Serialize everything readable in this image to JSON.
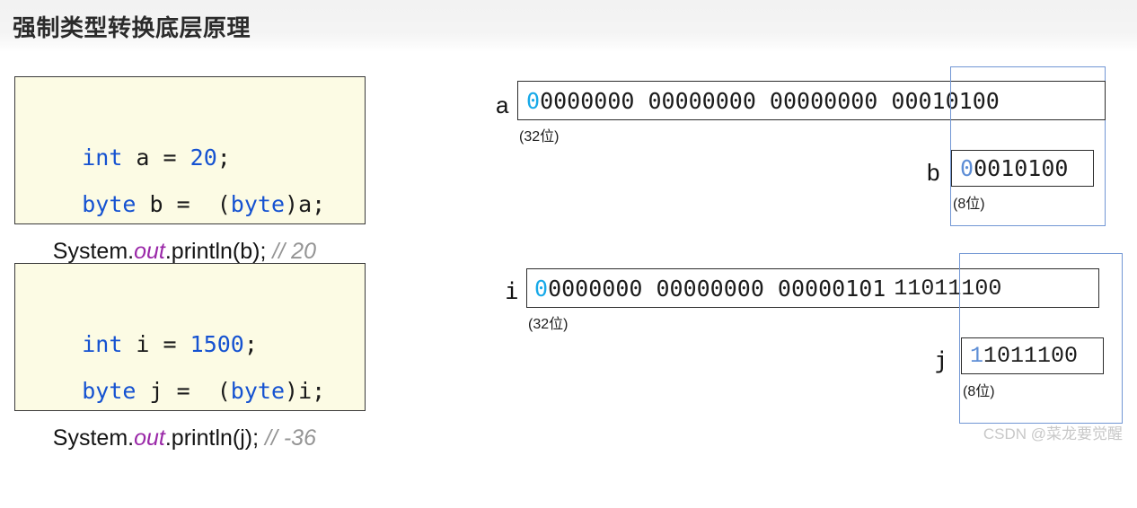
{
  "header": {
    "title": "强制类型转换底层原理"
  },
  "code_blocks": [
    {
      "id": "code-box-1",
      "lines": [
        {
          "type": "mono",
          "parts": [
            {
              "text": "int",
              "style": "kw"
            },
            {
              "text": " a = ",
              "style": "plain"
            },
            {
              "text": "20",
              "style": "num"
            },
            {
              "text": ";",
              "style": "plain"
            }
          ]
        },
        {
          "type": "mono",
          "parts": [
            {
              "text": "byte",
              "style": "kw"
            },
            {
              "text": " b =  (",
              "style": "plain"
            },
            {
              "text": "byte",
              "style": "kw"
            },
            {
              "text": ")a;",
              "style": "plain"
            }
          ]
        },
        {
          "type": "sans",
          "parts": [
            {
              "text": "System.",
              "style": "plain"
            },
            {
              "text": "out",
              "style": "out"
            },
            {
              "text": ".println(b); ",
              "style": "plain"
            },
            {
              "text": "// 20",
              "style": "cmt"
            }
          ]
        }
      ]
    },
    {
      "id": "code-box-2",
      "lines": [
        {
          "type": "mono",
          "parts": [
            {
              "text": "int",
              "style": "kw"
            },
            {
              "text": " i = ",
              "style": "plain"
            },
            {
              "text": "1500",
              "style": "num"
            },
            {
              "text": ";",
              "style": "plain"
            }
          ]
        },
        {
          "type": "mono",
          "parts": [
            {
              "text": "byte",
              "style": "kw"
            },
            {
              "text": " j =  (",
              "style": "plain"
            },
            {
              "text": "byte",
              "style": "kw"
            },
            {
              "text": ")i;",
              "style": "plain"
            }
          ]
        },
        {
          "type": "sans",
          "parts": [
            {
              "text": "System.",
              "style": "plain"
            },
            {
              "text": "out",
              "style": "out"
            },
            {
              "text": ".println(j); ",
              "style": "plain"
            },
            {
              "text": "// -36",
              "style": "cmt"
            }
          ]
        }
      ]
    }
  ],
  "diagrams": [
    {
      "id": "diagram-1",
      "wide": {
        "label": "a",
        "note": "(32位)",
        "bit_groups": [
          "00000000",
          "00000000",
          "00000000",
          "00010100"
        ],
        "highlight_first_char": "0",
        "highlight_color": "#17a9e8",
        "full_bits": "00000000 00000000 00000000 00010100"
      },
      "narrow": {
        "label": "b",
        "note": "(8位)",
        "bits": "00010100",
        "highlight_first_char": "0",
        "highlight_color": "#5e8ed6"
      }
    },
    {
      "id": "diagram-2",
      "wide": {
        "label": "i",
        "note": "(32位)",
        "bit_groups": [
          "00000000",
          "00000000",
          "00000101",
          "11011100"
        ],
        "highlight_first_char": "0",
        "highlight_color": "#17a9e8",
        "full_bits": "00000000 00000000 00000101 11011100"
      },
      "narrow": {
        "label": "j",
        "note": "(8位)",
        "bits": "11011100",
        "highlight_first_char": "1",
        "highlight_color": "#5e8ed6"
      }
    }
  ],
  "watermark": {
    "text": "CSDN @菜龙要觉醒"
  },
  "colors": {
    "keyword": "#1552d1",
    "number": "#1552d1",
    "out_field": "#9a28a8",
    "comment": "#949494",
    "code_bg": "#fcfbe4",
    "code_border": "#3a3a3a",
    "blue_frame": "#7196d4",
    "bits_border": "#2c2c2c",
    "title": "#2b2b2b"
  }
}
